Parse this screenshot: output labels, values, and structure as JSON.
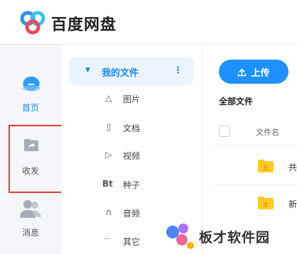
{
  "app": {
    "title": "百度网盘"
  },
  "rail": {
    "items": [
      {
        "label": "首页",
        "icon": "cloud-icon",
        "active": true
      },
      {
        "label": "收发",
        "icon": "share-folder-icon",
        "active": false
      },
      {
        "label": "消息",
        "icon": "contacts-icon",
        "active": false
      }
    ]
  },
  "nav": {
    "my_files": "我的文件",
    "more": "⋮",
    "items": [
      {
        "label": "图片",
        "icon": "image-icon",
        "glyph": "△"
      },
      {
        "label": "文档",
        "icon": "document-icon",
        "glyph": "▯"
      },
      {
        "label": "视频",
        "icon": "video-icon",
        "glyph": "▷"
      },
      {
        "label": "种子",
        "icon": "torrent-icon",
        "glyph": "Bt"
      },
      {
        "label": "音频",
        "icon": "headphones-icon",
        "glyph": "∩"
      },
      {
        "label": "其它",
        "icon": "more-icon",
        "glyph": "···"
      }
    ]
  },
  "main": {
    "upload_label": "上传",
    "section_title": "全部文件",
    "column_filename": "文件名",
    "rows": [
      {
        "name": "共"
      },
      {
        "name": "新"
      }
    ]
  },
  "watermark": {
    "text": "板才软件园"
  },
  "colors": {
    "accent": "#1e90ff",
    "annotation": "#e53935",
    "folder": "#ffca28"
  }
}
